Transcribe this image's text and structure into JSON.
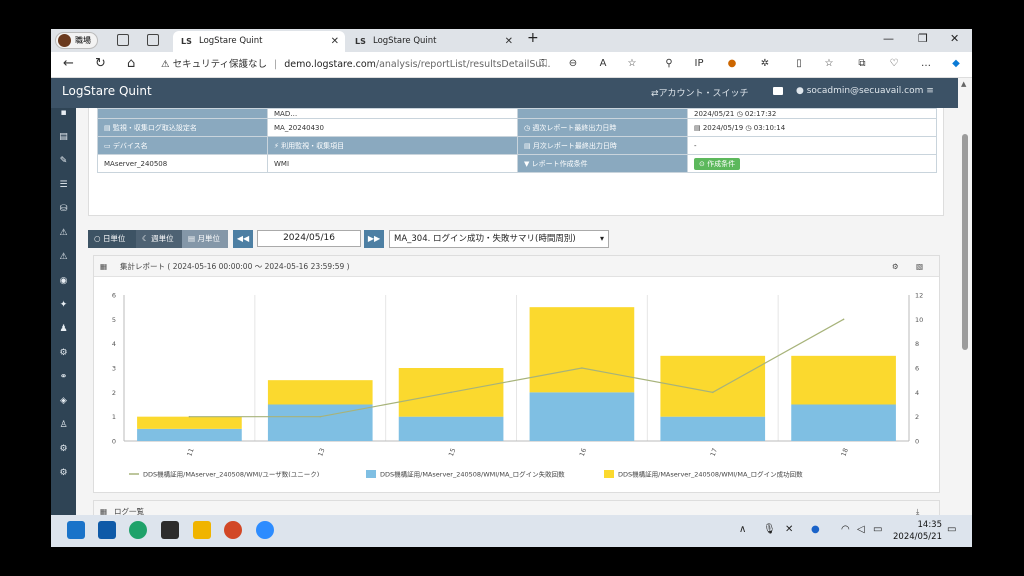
{
  "browser": {
    "profile_label": "職場",
    "tabs": [
      {
        "label": "LogStare Quint",
        "icon": "LS"
      },
      {
        "label": "LogStare Quint",
        "icon": "LS"
      }
    ],
    "security_label": "セキュリティ保護なし",
    "url_domain": "demo.logstare.com",
    "url_path": "/analysis/reportList/resultsDetailSu..."
  },
  "app": {
    "title": "LogStare Quint",
    "account_switch": "⇄アカウント・スイッチ",
    "user": "socadmin@secuavail.com"
  },
  "info": {
    "rows": [
      {
        "label1": "",
        "value1": "MAD…",
        "label2": "",
        "value2": "2024/05/21 ◷ 02:17:32"
      },
      {
        "label1": "監視・収集ログ取込設定名",
        "value1": "MA_20240430",
        "label2": "週次レポート最終出力日時",
        "value2": "2024/05/19 ◷ 03:10:14"
      },
      {
        "label1": "デバイス名",
        "value1": "",
        "label2": "月次レポート最終出力日時",
        "value2": "-"
      },
      {
        "label1": "MAserver_240508",
        "value1": "WMI",
        "label2": "レポート作成条件",
        "value2": ""
      }
    ],
    "device_col2_label": "利用監視・収集項目",
    "make_condition_btn": "作成条件"
  },
  "controls": {
    "day_label": "日単位",
    "week_label": "週単位",
    "month_label": "月単位",
    "date_value": "2024/05/16",
    "report_selected": "MA_304. ログイン成功・失敗サマリ(時間周別)"
  },
  "chart_panel": {
    "title": "集計レポート ( 2024-05-16 00:00:00 ～ 2024-05-16 23:59:59 )"
  },
  "log_panel": {
    "title": "ログ一覧"
  },
  "chart_data": {
    "type": "bar",
    "categories": [
      "11",
      "13",
      "15",
      "16",
      "17",
      "18"
    ],
    "series": [
      {
        "name": "DDS機構証用/MAserver_240508/WMI/MA_ログイン失敗回数",
        "type": "bar",
        "values": [
          0.5,
          1.5,
          1,
          2,
          1,
          1.5
        ],
        "color": "#7fbfe3"
      },
      {
        "name": "DDS機構証用/MAserver_240508/WMI/MA_ログイン成功回数",
        "type": "bar",
        "values": [
          0.5,
          1,
          2,
          3.5,
          2.5,
          2
        ],
        "color": "#fbd92e"
      },
      {
        "name": "DDS機構証用/MAserver_240508/WMI/ユーザ数(ユニーク)",
        "type": "line",
        "axis": "right",
        "values": [
          2,
          2,
          4,
          6,
          4,
          10
        ],
        "color": "#a7b37a"
      }
    ],
    "ylim_left": [
      0,
      6
    ],
    "ylim_right": [
      0,
      12
    ],
    "yticks_left": [
      "0",
      "1",
      "2",
      "3",
      "4",
      "5",
      "6"
    ],
    "yticks_right": [
      "0",
      "2",
      "4",
      "6",
      "8",
      "10",
      "12"
    ],
    "grid": "vertical",
    "legend": "bottom"
  },
  "taskbar": {
    "time": "14:35",
    "date": "2024/05/21"
  }
}
